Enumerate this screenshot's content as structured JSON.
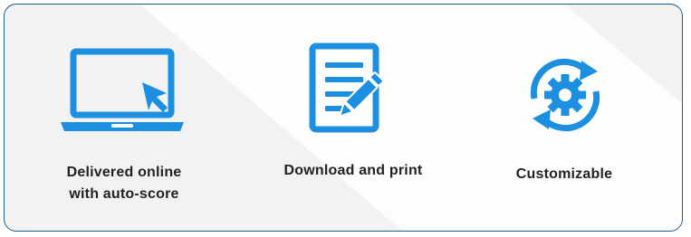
{
  "features": [
    {
      "label": "Delivered online\nwith auto-score",
      "icon": "laptop-cursor-icon"
    },
    {
      "label": "Download and print",
      "icon": "document-pencil-icon"
    },
    {
      "label": "Customizable",
      "icon": "gear-refresh-icon"
    }
  ],
  "colors": {
    "icon_blue": "#1d8fe0",
    "border": "#1b5c8e",
    "text": "#222222",
    "background": "#f2f2f2"
  }
}
